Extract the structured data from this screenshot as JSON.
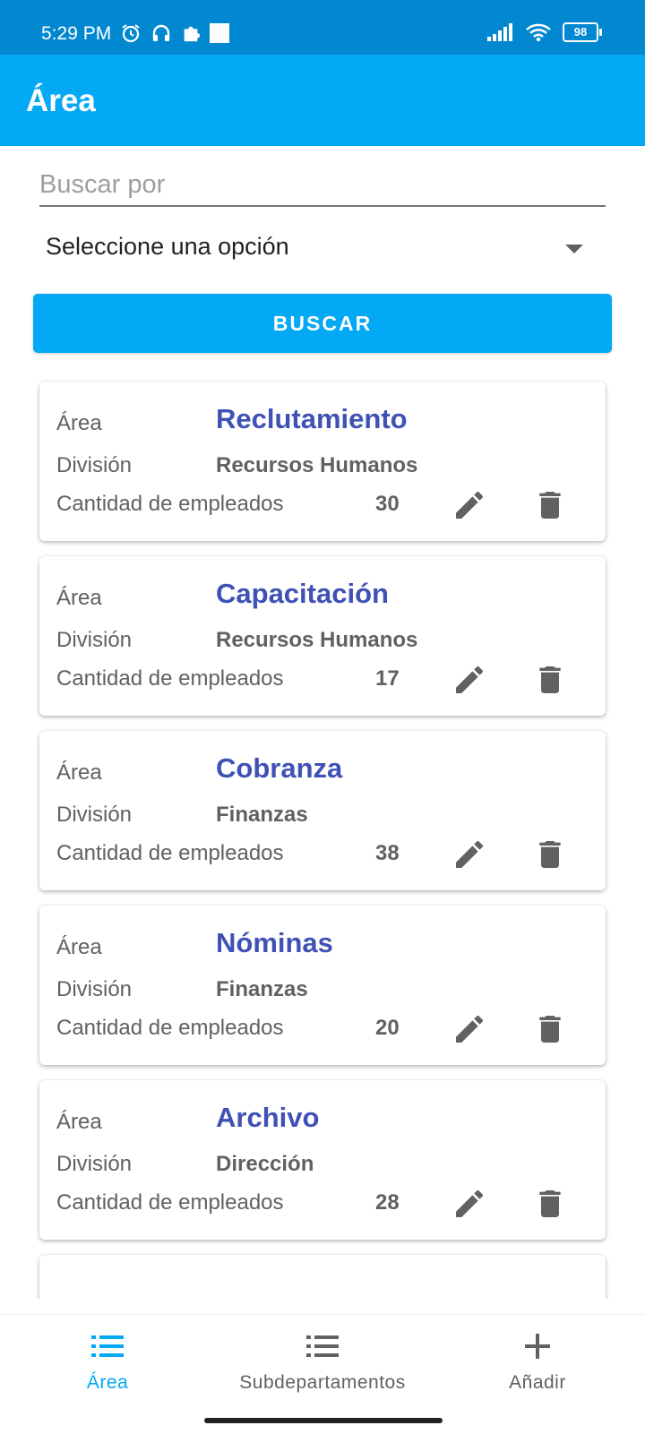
{
  "status_bar": {
    "time": "5:29 PM",
    "battery": "98",
    "icons_left": [
      "alarm-icon",
      "headset-icon",
      "puzzle-icon",
      "square-icon"
    ],
    "icons_right": [
      "signal-icon",
      "wifi-icon",
      "battery-icon"
    ]
  },
  "app_bar": {
    "title": "Área"
  },
  "search": {
    "placeholder": "Buscar por",
    "value": ""
  },
  "select": {
    "label": "Seleccione una opción"
  },
  "button": {
    "label": "BUSCAR"
  },
  "labels": {
    "area": "Área",
    "division": "División",
    "count": "Cantidad de empleados"
  },
  "cards": [
    {
      "area": "Reclutamiento",
      "division": "Recursos Humanos",
      "count": "30"
    },
    {
      "area": "Capacitación",
      "division": "Recursos Humanos",
      "count": "17"
    },
    {
      "area": "Cobranza",
      "division": "Finanzas",
      "count": "38"
    },
    {
      "area": "Nóminas",
      "division": "Finanzas",
      "count": "20"
    },
    {
      "area": "Archivo",
      "division": "Dirección",
      "count": "28"
    }
  ],
  "bottom_nav": {
    "items": [
      {
        "label": "Área",
        "icon": "list-icon",
        "active": true
      },
      {
        "label": "Subdepartamentos",
        "icon": "list-icon",
        "active": false
      },
      {
        "label": "Añadir",
        "icon": "plus-icon",
        "active": false
      }
    ]
  },
  "colors": {
    "status_bar": "#0288d1",
    "app_bar": "#03a9f4",
    "accent": "#03a9f4",
    "area_title": "#3f51b5",
    "secondary_text": "#616161"
  }
}
